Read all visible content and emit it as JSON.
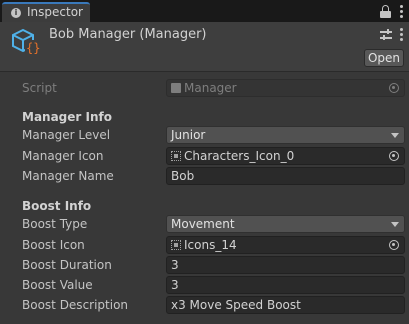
{
  "tab": {
    "label": "Inspector",
    "icon": "info-icon"
  },
  "header": {
    "title": "Bob Manager (Manager)",
    "open_label": "Open",
    "accent": "#4fb1e8",
    "brace_color": "#e8722a"
  },
  "script_row": {
    "label": "Script",
    "value": "Manager"
  },
  "manager_info": {
    "heading": "Manager Info",
    "level": {
      "label": "Manager Level",
      "value": "Junior"
    },
    "icon": {
      "label": "Manager Icon",
      "value": "Characters_Icon_0"
    },
    "name": {
      "label": "Manager Name",
      "value": "Bob"
    }
  },
  "boost_info": {
    "heading": "Boost Info",
    "type": {
      "label": "Boost Type",
      "value": "Movement"
    },
    "icon": {
      "label": "Boost Icon",
      "value": "Icons_14"
    },
    "duration": {
      "label": "Boost Duration",
      "value": "3"
    },
    "value": {
      "label": "Boost Value",
      "value": "3"
    },
    "description": {
      "label": "Boost Description",
      "value": "x3 Move Speed Boost"
    }
  }
}
